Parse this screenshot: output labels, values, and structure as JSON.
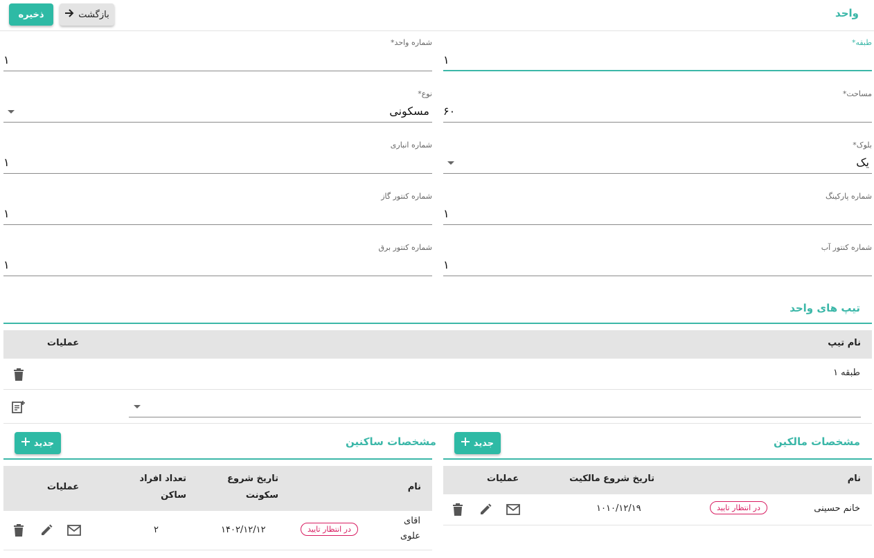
{
  "header": {
    "title": "واحد",
    "save_label": "ذخیره",
    "back_label": "بازگشت"
  },
  "form": {
    "floor": {
      "label": "طبقه*",
      "value": "۱"
    },
    "unit_number": {
      "label": "شماره واحد*",
      "value": "۱"
    },
    "area": {
      "label": "مساحت*",
      "value": "۶۰"
    },
    "type": {
      "label": "نوع*",
      "value": "مسکونی"
    },
    "block": {
      "label": "بلوک*",
      "value": "یک"
    },
    "storage_number": {
      "label": "شماره انباری",
      "value": "۱"
    },
    "parking_number": {
      "label": "شماره پارکینگ",
      "value": "۱"
    },
    "gas_meter": {
      "label": "شماره کنتور گاز",
      "value": "۱"
    },
    "water_meter": {
      "label": "شماره کنتور آب",
      "value": "۱"
    },
    "electric_meter": {
      "label": "شماره کنتور برق",
      "value": "۱"
    }
  },
  "unit_types": {
    "title": "تیپ های واحد",
    "col_name": "نام تیپ",
    "col_actions": "عملیات",
    "rows": [
      {
        "name": "طبقه ۱"
      }
    ]
  },
  "owners": {
    "title": "مشخصات مالکین",
    "new_label": "جدید",
    "col_name": "نام",
    "col_start": "تاریخ شروع مالکیت",
    "col_actions": "عملیات",
    "rows": [
      {
        "name": "خانم حسینی",
        "status": "در انتظار تایید",
        "start": "۱۰۱۰/۱۲/۱۹"
      }
    ]
  },
  "residents": {
    "title": "مشخصات ساکنین",
    "new_label": "جدید",
    "col_name": "نام",
    "col_start_1": "تاریخ شروع",
    "col_start_2": "سکونت",
    "col_count_1": "تعداد افراد",
    "col_count_2": "ساکن",
    "col_actions": "عملیات",
    "rows": [
      {
        "name_1": "اقای",
        "name_2": "علوی",
        "status": "در انتظار تایید",
        "start": "۱۴۰۲/۱۲/۱۲",
        "count": "۲"
      }
    ]
  },
  "colors": {
    "accent": "#3bb7a8",
    "button": "#2ebaa5",
    "pending": "#d81b60"
  },
  "icons": [
    "arrow-right-icon",
    "delete-icon",
    "edit-icon",
    "mail-icon",
    "playlist-add-icon",
    "plus-icon",
    "dropdown-caret-icon"
  ]
}
